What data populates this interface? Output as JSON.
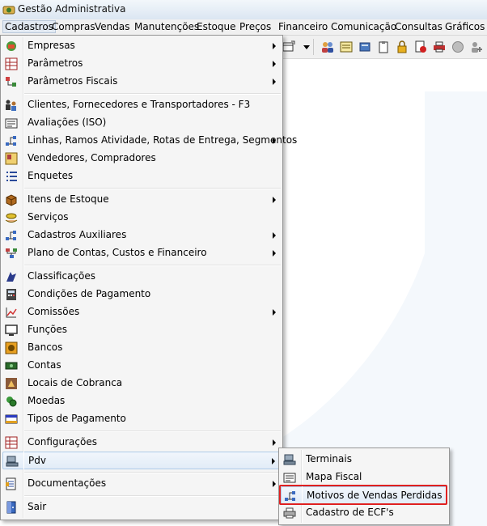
{
  "window": {
    "title": "Gestão Administrativa"
  },
  "menubar": {
    "items": [
      {
        "label": "Cadastros"
      },
      {
        "label": "Compras"
      },
      {
        "label": "Vendas"
      },
      {
        "label": "Manutenções"
      },
      {
        "label": "Estoque"
      },
      {
        "label": "Preços"
      },
      {
        "label": "Financeiro"
      },
      {
        "label": "Comunicação"
      },
      {
        "label": "Consultas"
      },
      {
        "label": "Gráficos"
      }
    ]
  },
  "cadastros_menu": {
    "items": [
      {
        "label": "Empresas",
        "icon": "companies-icon",
        "submenu": true
      },
      {
        "label": "Parâmetros",
        "icon": "parameters-icon",
        "submenu": true
      },
      {
        "label": "Parâmetros Fiscais",
        "icon": "fiscal-parameters-icon",
        "submenu": true
      },
      {
        "label": "Clientes, Fornecedores e Transportadores - F3",
        "icon": "people-icon",
        "submenu": false
      },
      {
        "label": "Avaliações (ISO)",
        "icon": "evaluation-icon",
        "submenu": false
      },
      {
        "label": "Linhas, Ramos Atividade, Rotas de Entrega, Segmentos",
        "icon": "network-icon",
        "submenu": true
      },
      {
        "label": "Vendedores, Compradores",
        "icon": "contacts-card-icon",
        "submenu": false
      },
      {
        "label": "Enquetes",
        "icon": "list-icon",
        "submenu": false
      },
      {
        "label": "Itens de Estoque",
        "icon": "box-icon",
        "submenu": true
      },
      {
        "label": "Serviços",
        "icon": "service-hand-icon",
        "submenu": false
      },
      {
        "label": "Cadastros Auxiliares",
        "icon": "network-icon",
        "submenu": true
      },
      {
        "label": "Plano de Contas, Custos e Financeiro",
        "icon": "chart-of-accounts-icon",
        "submenu": true
      },
      {
        "label": "Classificações",
        "icon": "classification-icon",
        "submenu": false
      },
      {
        "label": "Condições de Pagamento",
        "icon": "calculator-icon",
        "submenu": false
      },
      {
        "label": "Comissões",
        "icon": "commission-chart-icon",
        "submenu": true
      },
      {
        "label": "Funções",
        "icon": "monitor-icon",
        "submenu": false
      },
      {
        "label": "Bancos",
        "icon": "bank-icon",
        "submenu": false
      },
      {
        "label": "Contas",
        "icon": "money-icon",
        "submenu": false
      },
      {
        "label": "Locais de Cobranca",
        "icon": "location-icon",
        "submenu": false
      },
      {
        "label": "Moedas",
        "icon": "coins-icon",
        "submenu": false
      },
      {
        "label": "Tipos de Pagamento",
        "icon": "credit-card-icon",
        "submenu": false
      },
      {
        "label": "Configurações",
        "icon": "settings-grid-icon",
        "submenu": true
      },
      {
        "label": "Pdv",
        "icon": "pos-terminal-icon",
        "submenu": true
      },
      {
        "label": "Documentações",
        "icon": "document-icon",
        "submenu": true
      },
      {
        "label": "Sair",
        "icon": "exit-door-icon",
        "submenu": false
      }
    ]
  },
  "pdv_submenu": {
    "items": [
      {
        "label": "Terminais",
        "icon": "terminal-icon"
      },
      {
        "label": "Mapa Fiscal",
        "icon": "fiscal-map-icon"
      },
      {
        "label": "Motivos de Vendas Perdidas",
        "icon": "network-icon"
      },
      {
        "label": "Cadastro de ECF's",
        "icon": "printer-icon"
      }
    ]
  },
  "colors": {
    "highlight_border": "#e02020",
    "menu_bg": "#f5f5f5",
    "hover_bg": "#e2ecf7"
  }
}
